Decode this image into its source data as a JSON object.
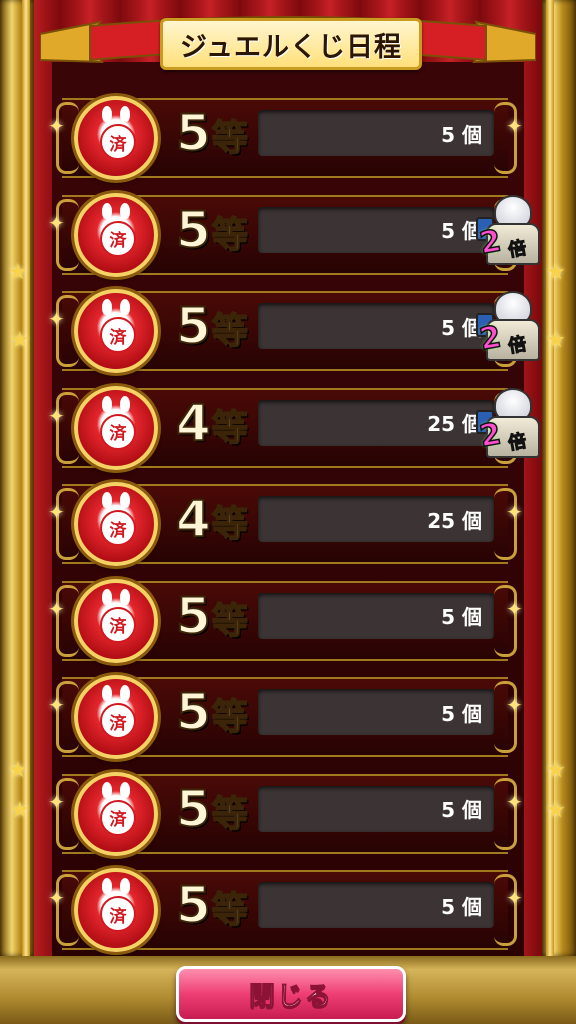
{
  "header": {
    "title": "ジュエルくじ日程"
  },
  "rows": [
    {
      "stamp": "済",
      "rank_num": "5",
      "rank_suffix": "等",
      "count": "5 個",
      "bonus_badge": false
    },
    {
      "stamp": "済",
      "rank_num": "5",
      "rank_suffix": "等",
      "count": "5 個",
      "bonus_badge": true
    },
    {
      "stamp": "済",
      "rank_num": "5",
      "rank_suffix": "等",
      "count": "5 個",
      "bonus_badge": true
    },
    {
      "stamp": "済",
      "rank_num": "4",
      "rank_suffix": "等",
      "count": "25 個",
      "bonus_badge": true
    },
    {
      "stamp": "済",
      "rank_num": "4",
      "rank_suffix": "等",
      "count": "25 個",
      "bonus_badge": false
    },
    {
      "stamp": "済",
      "rank_num": "5",
      "rank_suffix": "等",
      "count": "5 個",
      "bonus_badge": false
    },
    {
      "stamp": "済",
      "rank_num": "5",
      "rank_suffix": "等",
      "count": "5 個",
      "bonus_badge": false
    },
    {
      "stamp": "済",
      "rank_num": "5",
      "rank_suffix": "等",
      "count": "5 個",
      "bonus_badge": false
    },
    {
      "stamp": "済",
      "rank_num": "5",
      "rank_suffix": "等",
      "count": "5 個",
      "bonus_badge": false
    }
  ],
  "bonus": {
    "label": "2",
    "sub": "倍"
  },
  "footer": {
    "close_label": "閉じる"
  },
  "colors": {
    "curtain": "#a5161a",
    "gold": "#f3d56b",
    "button": "#ee3e73"
  },
  "icons": {
    "medal": "used-ticket-medal-icon",
    "bonus": "character-bonus-icon"
  }
}
